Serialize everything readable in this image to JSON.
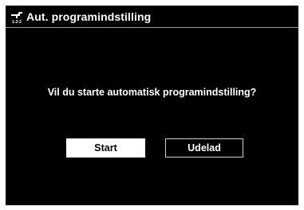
{
  "header": {
    "icon": "setup-wrench-123-icon",
    "icon_caption": "1-2-3",
    "title": "Aut. programindstilling"
  },
  "dialog": {
    "question": "Vil du starte automatisk programindstilling?"
  },
  "buttons": {
    "start_label": "Start",
    "cancel_label": "Udelad"
  },
  "colors": {
    "background": "#000000",
    "text": "#ffffff",
    "selected_button_bg": "#ffffff",
    "selected_button_text": "#000000",
    "header_divider": "#9a9a9a"
  }
}
